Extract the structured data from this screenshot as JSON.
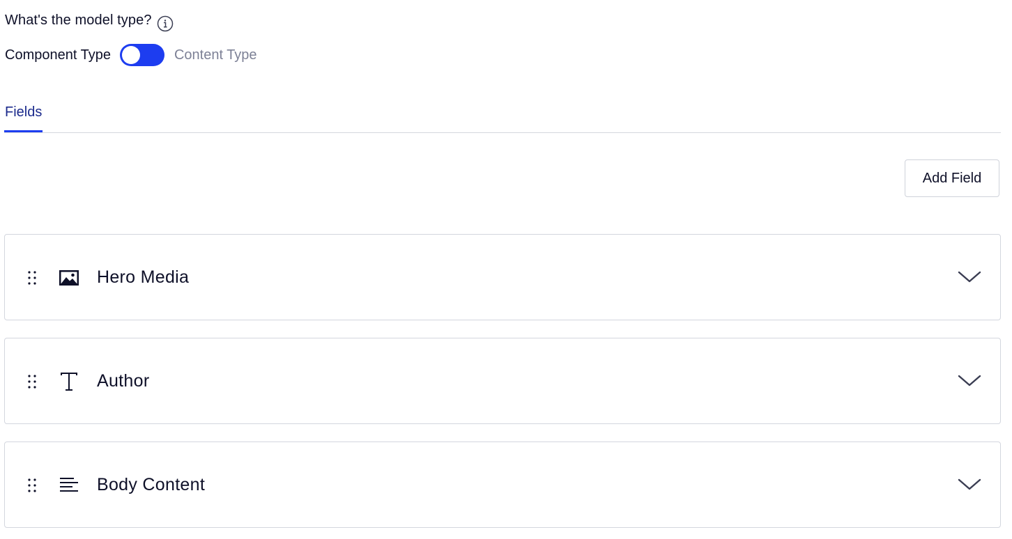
{
  "model_type": {
    "question": "What's the model type?",
    "info_icon": "info-icon",
    "left_option": "Component Type",
    "right_option": "Content Type",
    "toggle_state": "left",
    "toggle_color": "#1d3df0"
  },
  "tabs": [
    {
      "label": "Fields",
      "active": true
    }
  ],
  "toolbar": {
    "add_field_label": "Add Field"
  },
  "fields": [
    {
      "label": "Hero Media",
      "icon": "image-icon"
    },
    {
      "label": "Author",
      "icon": "text-icon"
    },
    {
      "label": "Body Content",
      "icon": "rich-text-icon"
    }
  ],
  "colors": {
    "accent": "#1d3df0",
    "muted_text": "#7d8196",
    "border": "#d3d6de"
  }
}
